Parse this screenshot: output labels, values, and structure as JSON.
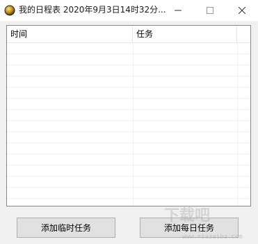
{
  "window": {
    "title": "我的日程表 2020年9月3日14时32分...",
    "minimize_symbol": "—",
    "maximize_symbol": "☐",
    "close_symbol": "✕"
  },
  "list": {
    "columns": [
      "时间",
      "任务"
    ],
    "rows": []
  },
  "buttons": {
    "add_temporary": "添加临时任务",
    "add_daily": "添加每日任务"
  },
  "watermark": {
    "text": "下载吧",
    "sub": "www.xiazaiba.com"
  }
}
